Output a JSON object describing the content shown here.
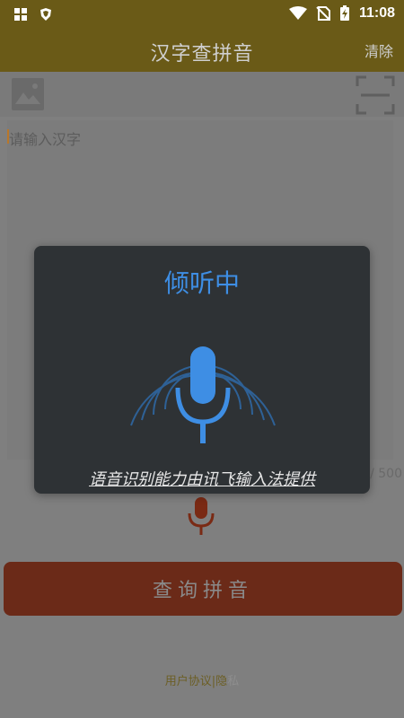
{
  "status_bar": {
    "time": "11:08",
    "left_icons": [
      "app-grid-icon",
      "shield-icon"
    ],
    "right_icons": [
      "wifi-icon",
      "no-sim-icon",
      "battery-charging-icon"
    ]
  },
  "header": {
    "title": "汉字查拼音",
    "clear_label": "清除"
  },
  "toolbar": {
    "image_icon": "image-icon",
    "scan_icon": "scan-icon"
  },
  "input": {
    "placeholder": "请输入汉字",
    "counter": "0 / 500"
  },
  "mic_icon": "microphone-icon",
  "query_button": {
    "label": "查询拼音"
  },
  "footer": {
    "text": "用户协议|隐",
    "fade_text": "私"
  },
  "dialog": {
    "title": "倾听中",
    "caption": "语音识别能力由讯飞输入法提供",
    "colors": {
      "accent": "#3e8ee4",
      "background": "#2e3235"
    }
  },
  "colors": {
    "appbar": "#6a5a17",
    "query_button": "#6b2a18"
  }
}
